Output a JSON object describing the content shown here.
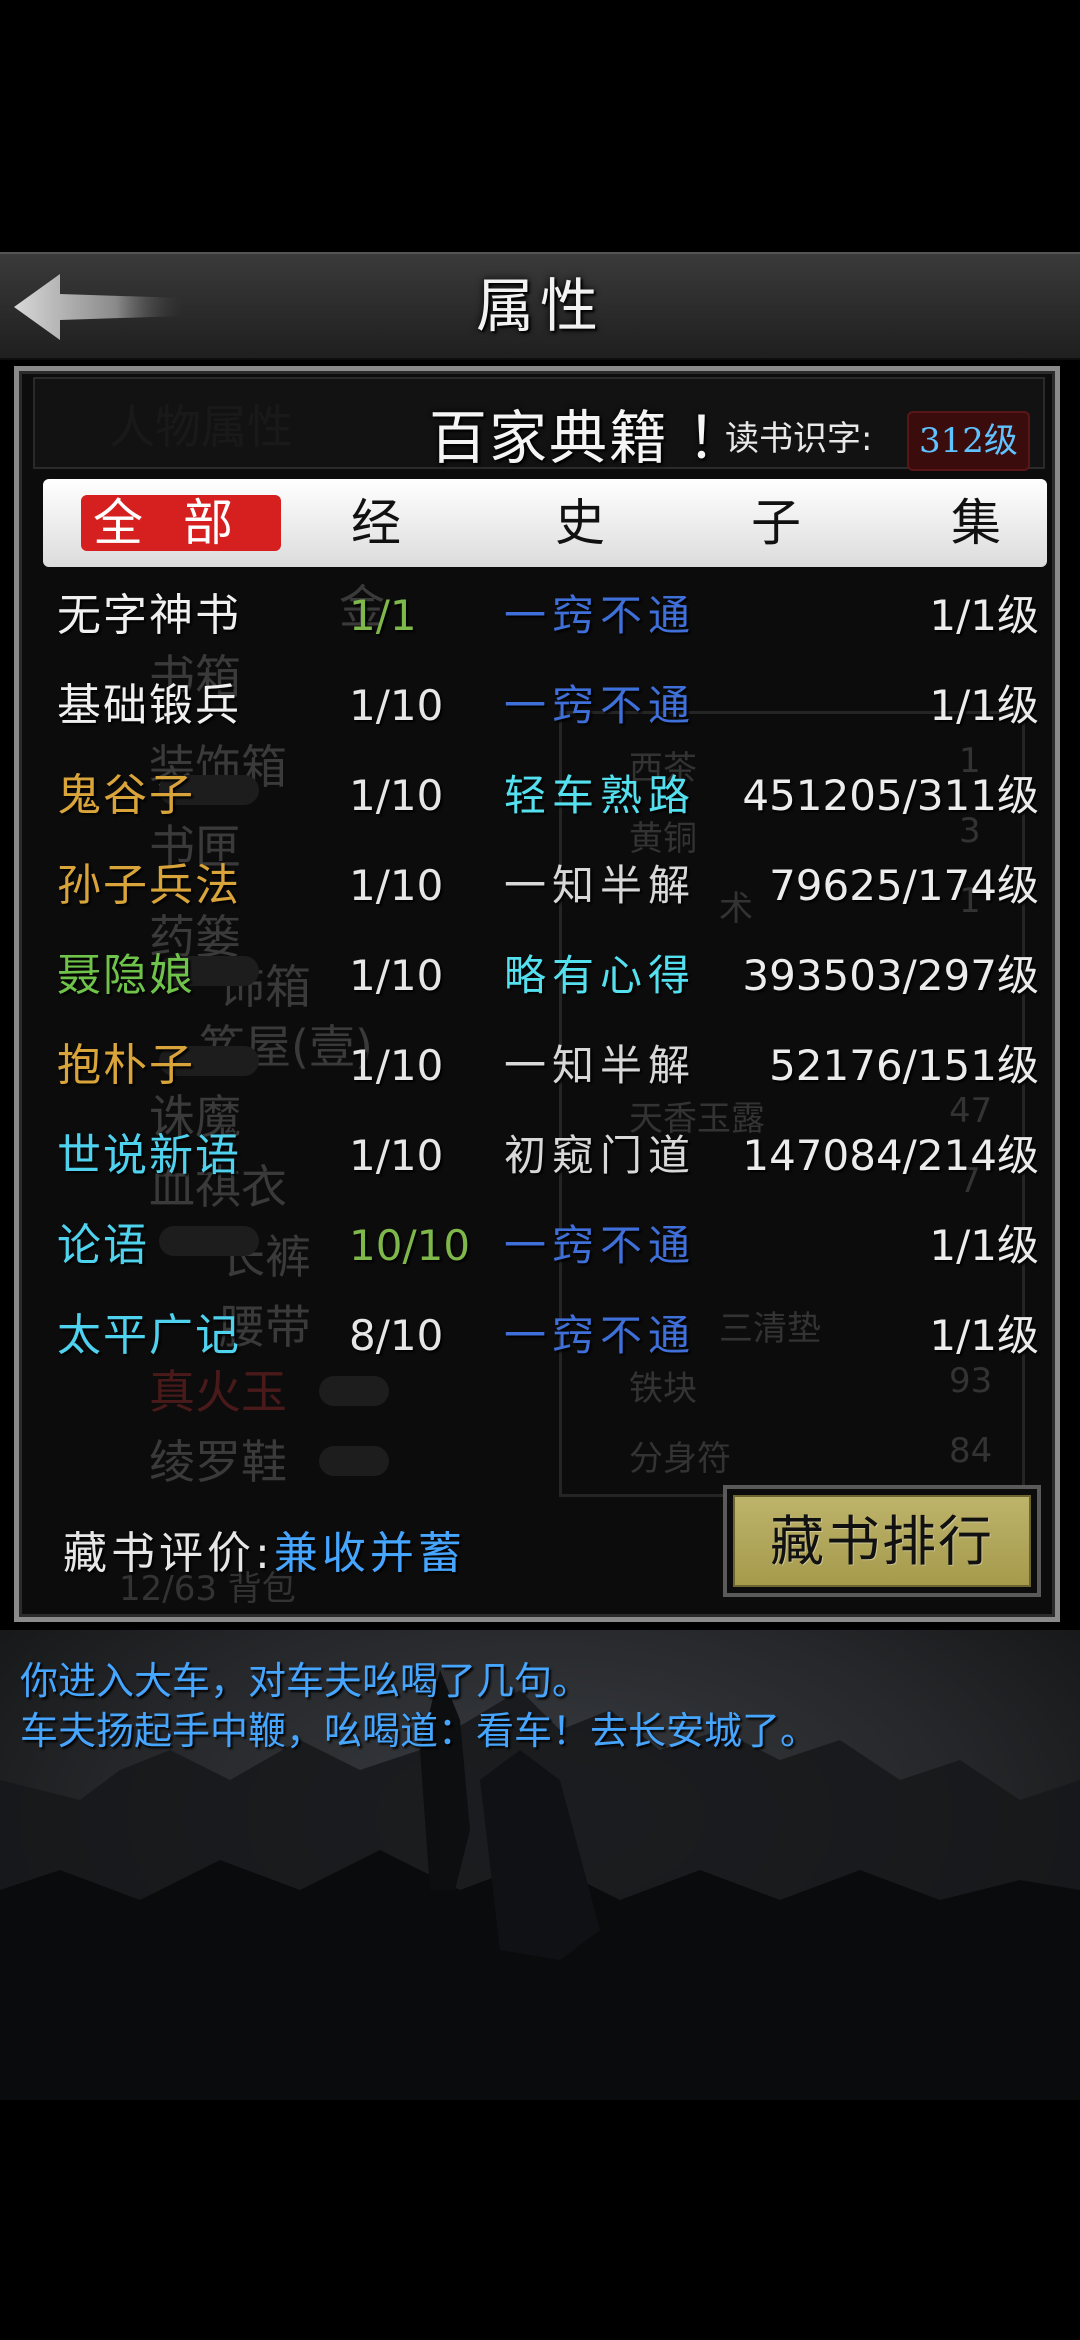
{
  "header": {
    "title": "属性"
  },
  "panel": {
    "background_ghost": [
      "人物属性",
      "金",
      "书箱",
      "装饰箱",
      "书匣",
      "药篓",
      "饰箱",
      "笈屋(壹)",
      "诛魔",
      "血祺衣",
      "长裤",
      "腰带",
      "真火玉",
      "绫罗鞋",
      "西茶",
      "黄铜",
      "术",
      "天香玉露",
      "三清垫",
      "铁块",
      "分身符",
      "12/63 背包",
      "47",
      "93",
      "84",
      "1",
      "3",
      "7",
      "1"
    ],
    "book_title": "百家典籍",
    "book_title_mark": "！",
    "reading_label": "读书识字:",
    "reading_level": "312级",
    "tabs": [
      {
        "label": "全部",
        "active": true
      },
      {
        "label": "经",
        "active": false
      },
      {
        "label": "史",
        "active": false
      },
      {
        "label": "子",
        "active": false
      },
      {
        "label": "集",
        "active": false
      }
    ],
    "books": [
      {
        "name": "无字神书",
        "name_color": "#f0f0f0",
        "progress": "1/1",
        "progress_color": "#7fb84a",
        "status": "一窍不通",
        "status_color": "#3f6fd8",
        "level": "1/1级"
      },
      {
        "name": "基础锻兵",
        "name_color": "#f0f0f0",
        "progress": "1/10",
        "progress_color": "#e6e6e6",
        "status": "一窍不通",
        "status_color": "#3f6fd8",
        "level": "1/1级"
      },
      {
        "name": "鬼谷子",
        "name_color": "#d9a43a",
        "progress": "1/10",
        "progress_color": "#e6e6e6",
        "status": "轻车熟路",
        "status_color": "#54e0ee",
        "level": "451205/311级"
      },
      {
        "name": "孙子兵法",
        "name_color": "#d9a43a",
        "progress": "1/10",
        "progress_color": "#e6e6e6",
        "status": "一知半解",
        "status_color": "#d8d8d8",
        "level": "79625/174级"
      },
      {
        "name": "聂隐娘",
        "name_color": "#6fc24a",
        "progress": "1/10",
        "progress_color": "#e6e6e6",
        "status": "略有心得",
        "status_color": "#54e0ee",
        "level": "393503/297级"
      },
      {
        "name": "抱朴子",
        "name_color": "#d9a43a",
        "progress": "1/10",
        "progress_color": "#e6e6e6",
        "status": "一知半解",
        "status_color": "#d8d8d8",
        "level": "52176/151级"
      },
      {
        "name": "世说新语",
        "name_color": "#4fd2ee",
        "progress": "1/10",
        "progress_color": "#e6e6e6",
        "status": "初窥门道",
        "status_color": "#d8d8d8",
        "level": "147084/214级"
      },
      {
        "name": "论语",
        "name_color": "#4fd2ee",
        "progress": "10/10",
        "progress_color": "#7fb84a",
        "status": "一窍不通",
        "status_color": "#3f6fd8",
        "level": "1/1级"
      },
      {
        "name": "太平广记",
        "name_color": "#4fd2ee",
        "progress": "8/10",
        "progress_color": "#e6e6e6",
        "status": "一窍不通",
        "status_color": "#3f6fd8",
        "level": "1/1级"
      }
    ],
    "collection_label": "藏书评价:",
    "collection_value": "兼收并蓄",
    "rank_button": "藏书排行"
  },
  "log": [
    "你进入大车，对车夫吆喝了几句。",
    "车夫扬起手中鞭，吆喝道：看车！去长安城了。"
  ]
}
